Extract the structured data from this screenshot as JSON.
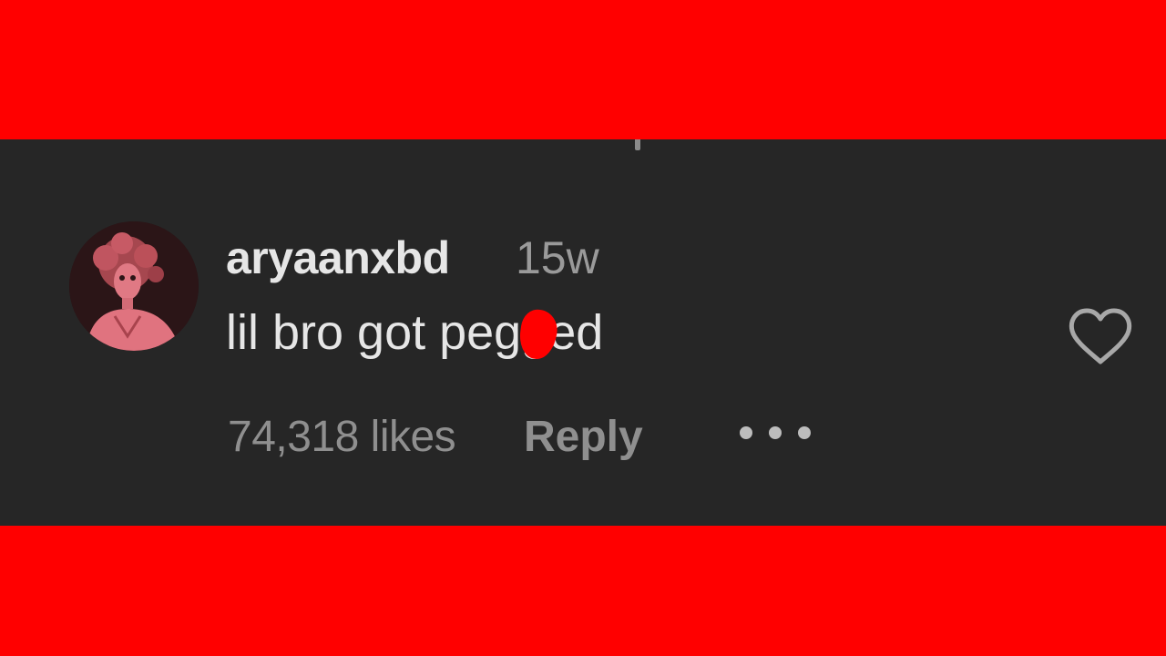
{
  "comment": {
    "username": "aryaanxbd",
    "timestamp": "15w",
    "text": "lil bro got pegged",
    "likes": "74,318 likes",
    "reply_label": "Reply",
    "liked": false
  },
  "icons": {
    "avatar": "avatar-image",
    "like": "heart-outline-icon",
    "more": "more-dots-icon"
  },
  "colors": {
    "banner": "#ff0000",
    "panel": "#262626",
    "censor": "#ff0000",
    "primary_text": "#e6e6e6",
    "secondary_text": "#8f8f8f"
  }
}
